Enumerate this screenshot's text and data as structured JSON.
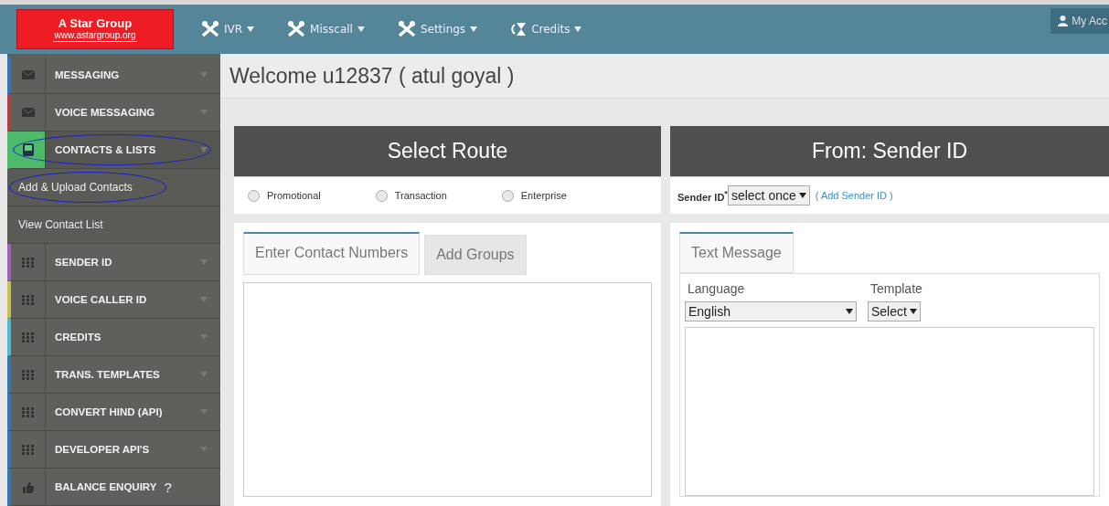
{
  "brand": {
    "name": "A Star Group",
    "url": "www.astargroup.org"
  },
  "nav": [
    {
      "label": "IVR",
      "kind": "wrench"
    },
    {
      "label": "Misscall",
      "kind": "wrench"
    },
    {
      "label": "Settings",
      "kind": "wrench"
    },
    {
      "label": "Credits",
      "kind": "hourglass"
    }
  ],
  "account": {
    "label": "My Acc"
  },
  "sidebar": {
    "items": [
      {
        "label": "MESSAGING",
        "kind": "envelope",
        "color": "#2f78b4",
        "expanded": false,
        "caret": true,
        "circled": false
      },
      {
        "label": "VOICE MESSAGING",
        "kind": "envelope",
        "color": "#b04040",
        "expanded": false,
        "caret": true,
        "circled": false
      },
      {
        "label": "CONTACTS & LISTS",
        "kind": "book",
        "color": "#4cba6a",
        "expanded": true,
        "caret": true,
        "circled": true,
        "children": [
          {
            "label": "Add & Upload Contacts",
            "circled": true
          },
          {
            "label": "View Contact List",
            "circled": false
          }
        ]
      },
      {
        "label": "SENDER ID",
        "kind": "grid",
        "color": "#a060c0",
        "expanded": false,
        "caret": true,
        "circled": false
      },
      {
        "label": "VOICE CALLER ID",
        "kind": "grid",
        "color": "#c8c050",
        "expanded": false,
        "caret": true,
        "circled": false
      },
      {
        "label": "CREDITS",
        "kind": "grid",
        "color": "#50b8d8",
        "expanded": false,
        "caret": true,
        "circled": false
      },
      {
        "label": "TRANS. TEMPLATES",
        "kind": "grid",
        "color": "#2f78b4",
        "expanded": false,
        "caret": true,
        "circled": false
      },
      {
        "label": "CONVERT HIND (API)",
        "kind": "grid",
        "color": "#2f78b4",
        "expanded": false,
        "caret": true,
        "circled": false
      },
      {
        "label": "DEVELOPER API'S",
        "kind": "grid",
        "color": "#2f78b4",
        "expanded": false,
        "caret": true,
        "circled": false
      },
      {
        "label": "BALANCE ENQUIRY",
        "kind": "thumb",
        "color": "#2f78b4",
        "expanded": false,
        "caret": false,
        "circled": false,
        "help": "?"
      }
    ]
  },
  "welcome": "Welcome u12837 ( atul goyal )",
  "route": {
    "title": "Select Route",
    "options": [
      {
        "label": "Promotional",
        "selected": false
      },
      {
        "label": "Transaction",
        "selected": false
      },
      {
        "label": "Enterprise",
        "selected": false
      }
    ]
  },
  "sender": {
    "title": "From: Sender ID",
    "label": "Sender ID$^{*}$",
    "value": "select once",
    "link": "( Add Sender ID )"
  },
  "contacts": {
    "tabs": [
      {
        "label": "Enter Contact Numbers",
        "selected": true
      },
      {
        "label": "Add Groups",
        "selected": false
      }
    ]
  },
  "message": {
    "tabs": [
      {
        "label": "Text Message",
        "selected": true
      }
    ],
    "language_label": "Language",
    "language": "English",
    "template_label": "Template",
    "template": "Select"
  }
}
